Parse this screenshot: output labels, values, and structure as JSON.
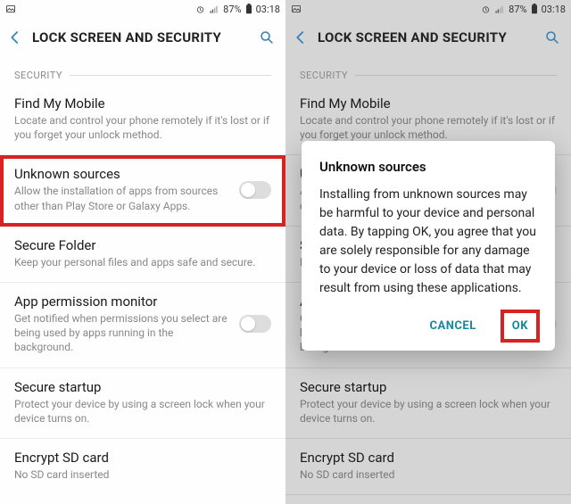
{
  "status": {
    "battery": "87%",
    "time": "03:18"
  },
  "appbar": {
    "title": "LOCK SCREEN AND SECURITY"
  },
  "section": {
    "label": "SECURITY"
  },
  "rows": {
    "findMyMobile": {
      "title": "Find My Mobile",
      "sub": "Locate and control your phone remotely if it's lost or if you forget your unlock method."
    },
    "unknownSources": {
      "title": "Unknown sources",
      "sub": "Allow the installation of apps from sources other than Play Store or Galaxy Apps."
    },
    "secureFolder": {
      "title": "Secure Folder",
      "sub": "Keep your personal files and apps safe and secure."
    },
    "appPermissionMonitor": {
      "title": "App permission monitor",
      "sub": "Get notified when permissions you select are being used by apps running in the background."
    },
    "secureStartup": {
      "title": "Secure startup",
      "sub": "Protect your device by using a screen lock when your device turns on."
    },
    "encryptSd": {
      "title": "Encrypt SD card",
      "sub": "No SD card inserted"
    }
  },
  "dialog": {
    "title": "Unknown sources",
    "body": "Installing from unknown sources may be harmful to your device and personal data. By tapping OK, you agree that you are solely responsible for any damage to your device or loss of data that may result from using these applications.",
    "cancel": "CANCEL",
    "ok": "OK"
  }
}
